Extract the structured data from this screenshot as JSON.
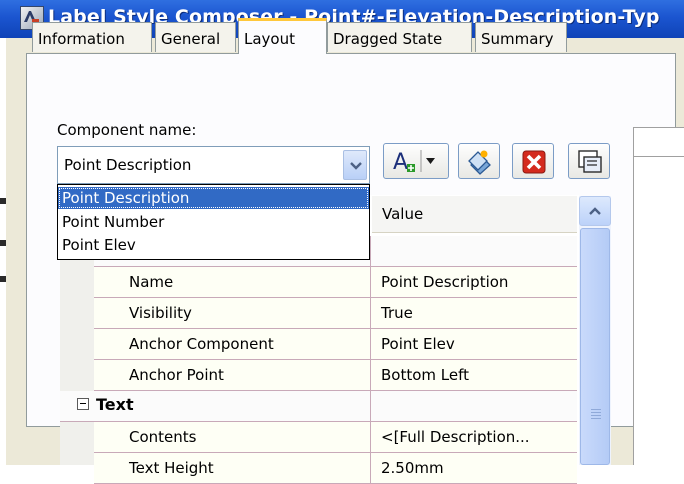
{
  "window": {
    "title": "Label Style Composer - Point#-Elevation-Description-Typ"
  },
  "tabs": [
    {
      "label": "Information"
    },
    {
      "label": "General"
    },
    {
      "label": "Layout"
    },
    {
      "label": "Dragged State"
    },
    {
      "label": "Summary"
    }
  ],
  "active_tab": "Layout",
  "component": {
    "label": "Component name:",
    "selected": "Point Description",
    "options": [
      "Point Description",
      "Point Number",
      "Point Elev"
    ]
  },
  "toolbar": {
    "icons": [
      "create-text-component-icon",
      "copy-component-icon",
      "delete-component-icon",
      "component-draw-order-icon"
    ],
    "create_glyph": "A"
  },
  "grid": {
    "value_header": "Value",
    "rows": [
      {
        "property": "Name",
        "value": "Point Description"
      },
      {
        "property": "Visibility",
        "value": "True"
      },
      {
        "property": "Anchor Component",
        "value": "Point Elev"
      },
      {
        "property": "Anchor Point",
        "value": "Bottom Left"
      }
    ],
    "text_category": "Text",
    "text_rows": [
      {
        "property": "Contents",
        "value": "<[Full Description..."
      },
      {
        "property": "Text Height",
        "value": "2.50mm"
      }
    ]
  },
  "colors": {
    "title_bar": "#1b55d0",
    "selection": "#316ac5",
    "active_tab_accent": "#ffc83c",
    "delete_red": "#d42a1e"
  }
}
